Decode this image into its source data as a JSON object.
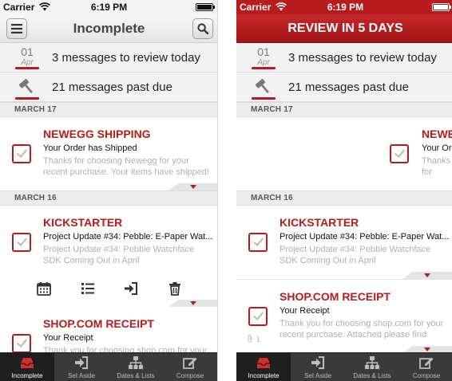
{
  "status_bar": {
    "carrier": "Carrier",
    "time": "6:19 PM"
  },
  "left": {
    "nav_title": "Incomplete",
    "summary": {
      "review": {
        "day": "01",
        "month": "Apr",
        "text": "3 messages to review today"
      },
      "past_due": {
        "text": "21 messages past due"
      }
    },
    "groups": [
      {
        "date": "MARCH 17",
        "messages": [
          {
            "sender": "NEWEGG SHIPPING",
            "subject": "Your Order has Shipped",
            "preview": "Thanks for choosing Newegg for your recent purchase. Your items have  shipped! Belo..."
          }
        ]
      },
      {
        "date": "MARCH 16",
        "messages": [
          {
            "sender": "KICKSTARTER",
            "subject": "Project Update #34: Pebble: E-Paper Wat...",
            "preview": "Project Update #34: Pebble Watchface SDK Coming Out in April  <http://www.kickstart..."
          },
          {
            "sender": "SHOP.COM RECEIPT",
            "subject": "Your Receipt",
            "preview": "Thank you for choosing shop.com for your"
          }
        ]
      }
    ],
    "actions": [
      {
        "name": "calendar-icon"
      },
      {
        "name": "list-icon"
      },
      {
        "name": "move-icon"
      },
      {
        "name": "trash-icon"
      }
    ]
  },
  "right": {
    "nav_title": "REVIEW IN 5 DAYS",
    "groups": [
      {
        "date": "MARCH 17",
        "messages": [
          {
            "sender": "NEWEGG SHIPPING",
            "subject": "Your Order has Shipped",
            "preview": "Thanks for choosing Newegg for your recent purchase. Your items have  shipped! Belo..."
          }
        ]
      },
      {
        "date": "MARCH 16",
        "messages": [
          {
            "sender": "KICKSTARTER",
            "subject": "Project Update #34: Pebble: E-Paper Wat...",
            "preview": "Project Update #34: Pebble Watchface SDK Coming Out in April  <http://www.kickstart..."
          },
          {
            "sender": "SHOP.COM RECEIPT",
            "subject": "Your Receipt",
            "preview": "Thank you for choosing shop.com for your recent purchase. Attached please  find you...",
            "attachment_count": "1"
          }
        ]
      }
    ]
  },
  "tab_bar": {
    "tabs": [
      {
        "label": "Incomplete",
        "icon": "inbox-icon",
        "active": true
      },
      {
        "label": "Set Aside",
        "icon": "set-aside-icon",
        "active": false
      },
      {
        "label": "Dates & Lists",
        "icon": "hierarchy-icon",
        "active": false
      },
      {
        "label": "Compose",
        "icon": "compose-icon",
        "active": false
      }
    ]
  },
  "colors": {
    "accent": "#b71c1c",
    "tab_bar": "#3a3a3a",
    "preview_text": "#b0b0b0"
  }
}
